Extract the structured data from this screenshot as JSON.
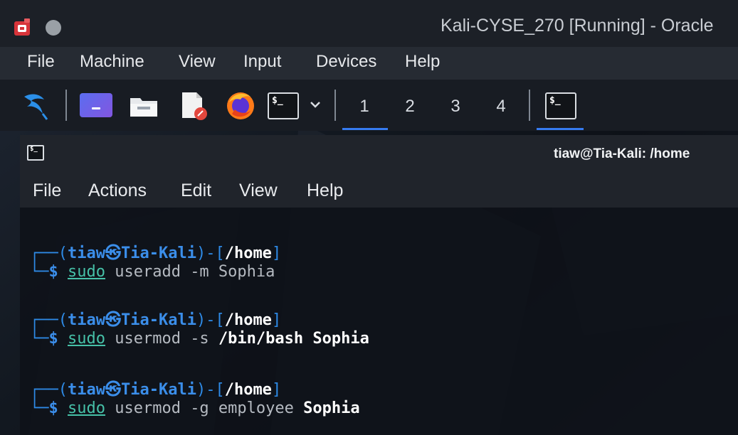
{
  "window": {
    "title": "Kali-CYSE_270 [Running] - Oracle"
  },
  "vbox_menu": [
    "File",
    "Machine",
    "View",
    "Input",
    "Devices",
    "Help"
  ],
  "panel": {
    "workspaces": [
      "1",
      "2",
      "3",
      "4"
    ],
    "icons": [
      "kali-menu-icon",
      "desktop-icon",
      "file-manager-icon",
      "text-editor-icon",
      "firefox-icon",
      "terminal-icon",
      "dropdown-chevron-icon",
      "terminal-task-icon"
    ]
  },
  "terminal": {
    "title": "tiaw@Tia-Kali: /home",
    "menu": [
      "File",
      "Actions",
      "Edit",
      "View",
      "Help"
    ],
    "prompt": {
      "user": "tiaw",
      "sep": "㉿",
      "host": "Tia-Kali",
      "path": "/home"
    },
    "commands": [
      {
        "sudo": "sudo",
        "rest": " useradd -m Sophia",
        "bold": ""
      },
      {
        "sudo": "sudo",
        "rest": " usermod -s ",
        "bold": "/bin/bash Sophia"
      },
      {
        "sudo": "sudo",
        "rest": " usermod -g employee ",
        "bold": "Sophia"
      }
    ]
  },
  "colors": {
    "accent": "#367bf0",
    "prompt_blue": "#2e8ae6",
    "titlebar": "#1c2027",
    "menubar": "#262b33"
  }
}
